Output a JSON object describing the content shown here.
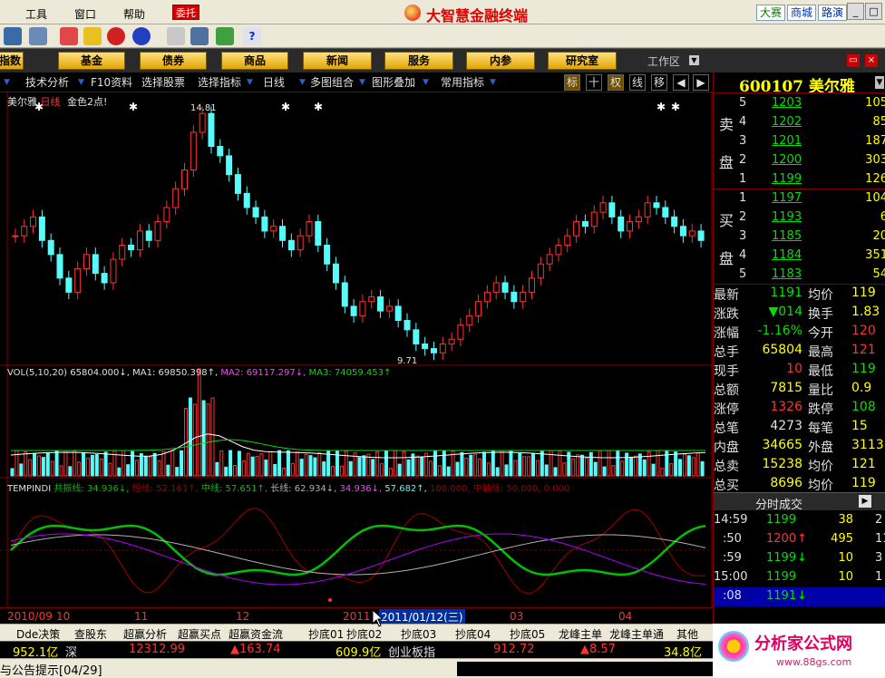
{
  "menu": {
    "tools": "工具",
    "window": "窗口",
    "help": "帮助",
    "delegate": "委托"
  },
  "app_title": "大智慧金融终端",
  "right_buttons": [
    "大赛",
    "商城",
    "路演"
  ],
  "tabs": [
    "指数",
    "基金",
    "债券",
    "商品",
    "新闻",
    "服务",
    "内参",
    "研究室"
  ],
  "workspace": "工作区",
  "chart_toolbar": {
    "tech": "技术分析",
    "f10": "F10资料",
    "select": "选择股票",
    "indicator": "选择指标",
    "period": "日线",
    "multi": "多图组合",
    "overlay": "图形叠加",
    "common": "常用指标",
    "b1": "标",
    "b2": "十",
    "b3": "权",
    "b4": "线",
    "b5": "移",
    "b6": "◀",
    "b7": "▶"
  },
  "kline": {
    "name": "美尔雅",
    "period": "日线",
    "signal": "金色2点!",
    "high_label": "14.81",
    "low_label": "9.71"
  },
  "vol_legend": {
    "base": "VOL(5,10,20)",
    "vol": "65804.000↓,",
    "ma1": "MA1: 69850.398↑,",
    "ma2": "MA2: 69117.297↓,",
    "ma3": "MA3: 74059.453↑"
  },
  "temp_legend": {
    "name": "TEMPINDI",
    "l1": "共振线: 34.936↓,",
    "l2": "短线: 52.161↑,",
    "l3": "中线: 57.651↑,",
    "l4": "长线: 62.934↓,",
    "l5": "34.936↓,",
    "l6": "57.682↑,",
    "l7": "100.000,",
    "l8": "中轴线:",
    "l9": "50.000,",
    "l10": "0.000"
  },
  "x_axis": {
    "d1": "2010/09",
    "d2": "10",
    "d3": "11",
    "d4": "12",
    "d5": "2011",
    "d6": "03",
    "d7": "04",
    "cursor": "2011/01/12(三)"
  },
  "stock": {
    "code": "600107",
    "name": "美尔雅"
  },
  "orderbook": {
    "sell_label": [
      "卖",
      "盘"
    ],
    "buy_label": [
      "买",
      "盘"
    ],
    "asks": [
      {
        "lvl": "5",
        "price": "1203",
        "vol": "105"
      },
      {
        "lvl": "4",
        "price": "1202",
        "vol": "85"
      },
      {
        "lvl": "3",
        "price": "1201",
        "vol": "187"
      },
      {
        "lvl": "2",
        "price": "1200",
        "vol": "303"
      },
      {
        "lvl": "1",
        "price": "1199",
        "vol": "126"
      }
    ],
    "bids": [
      {
        "lvl": "1",
        "price": "1197",
        "vol": "104"
      },
      {
        "lvl": "2",
        "price": "1193",
        "vol": "6"
      },
      {
        "lvl": "3",
        "price": "1185",
        "vol": "20"
      },
      {
        "lvl": "4",
        "price": "1184",
        "vol": "351"
      },
      {
        "lvl": "5",
        "price": "1183",
        "vol": "54"
      }
    ]
  },
  "quote": [
    {
      "l": "最新",
      "v": "1191",
      "l2": "均价",
      "v2": "119"
    },
    {
      "l": "涨跌",
      "v": "▼014",
      "l2": "换手",
      "v2": "1.83"
    },
    {
      "l": "涨幅",
      "v": "-1.16%",
      "l2": "今开",
      "v2": "120"
    },
    {
      "l": "总手",
      "v": "65804",
      "l2": "最高",
      "v2": "121"
    },
    {
      "l": "现手",
      "v": "10",
      "l2": "最低",
      "v2": "119"
    },
    {
      "l": "总额",
      "v": "7815",
      "l2": "量比",
      "v2": "0.9"
    },
    {
      "l": "涨停",
      "v": "1326",
      "l2": "跌停",
      "v2": "108"
    },
    {
      "l": "总笔",
      "v": "4273",
      "l2": "每笔",
      "v2": "15"
    },
    {
      "l": "内盘",
      "v": "34665",
      "l2": "外盘",
      "v2": "3113"
    },
    {
      "l": "总卖",
      "v": "15238",
      "l2": "均价",
      "v2": "121"
    },
    {
      "l": "总买",
      "v": "8696",
      "l2": "均价",
      "v2": "119"
    }
  ],
  "trades_header": "分时成交",
  "trades": [
    {
      "t": "14:59",
      "p": "1199",
      "a": "",
      "v": "38",
      "n": "2"
    },
    {
      "t": ":50",
      "p": "1200",
      "a": "↑",
      "v": "495",
      "n": "11"
    },
    {
      "t": ":59",
      "p": "1199",
      "a": "↓",
      "v": "10",
      "n": "3"
    },
    {
      "t": "15:00",
      "p": "1199",
      "a": "",
      "v": "10",
      "n": "1"
    },
    {
      "t": ":08",
      "p": "1191",
      "a": "↓",
      "v": "",
      "n": ""
    }
  ],
  "bottom_tabs": [
    "Dde决策",
    "查股东",
    "超赢分析",
    "超赢买点",
    "超赢资金流",
    "抄底01",
    "抄底02",
    "抄底03",
    "抄底04",
    "抄底05",
    "龙峰主单",
    "龙峰主单通",
    "其他"
  ],
  "ticker": {
    "v1": "952.1亿",
    "m1": "深",
    "v2": "12312.99",
    "v3": "▲163.74",
    "v4": "609.9亿",
    "m2": "创业板指",
    "v5": "912.72",
    "v6": "▲8.57",
    "v7": "34.8亿"
  },
  "status": {
    "notice": "与公告提示[04/29]"
  },
  "watermark": {
    "text": "分析家公式网",
    "url": "www.88gs.com"
  },
  "colors": {
    "up": "#ff3232",
    "down": "#54fcfc",
    "price": "#ffff00",
    "grid": "#800000",
    "green_line": "#00c000",
    "purple": "#b000ff",
    "white_line": "#e0e0e0",
    "brown": "#a00000"
  }
}
